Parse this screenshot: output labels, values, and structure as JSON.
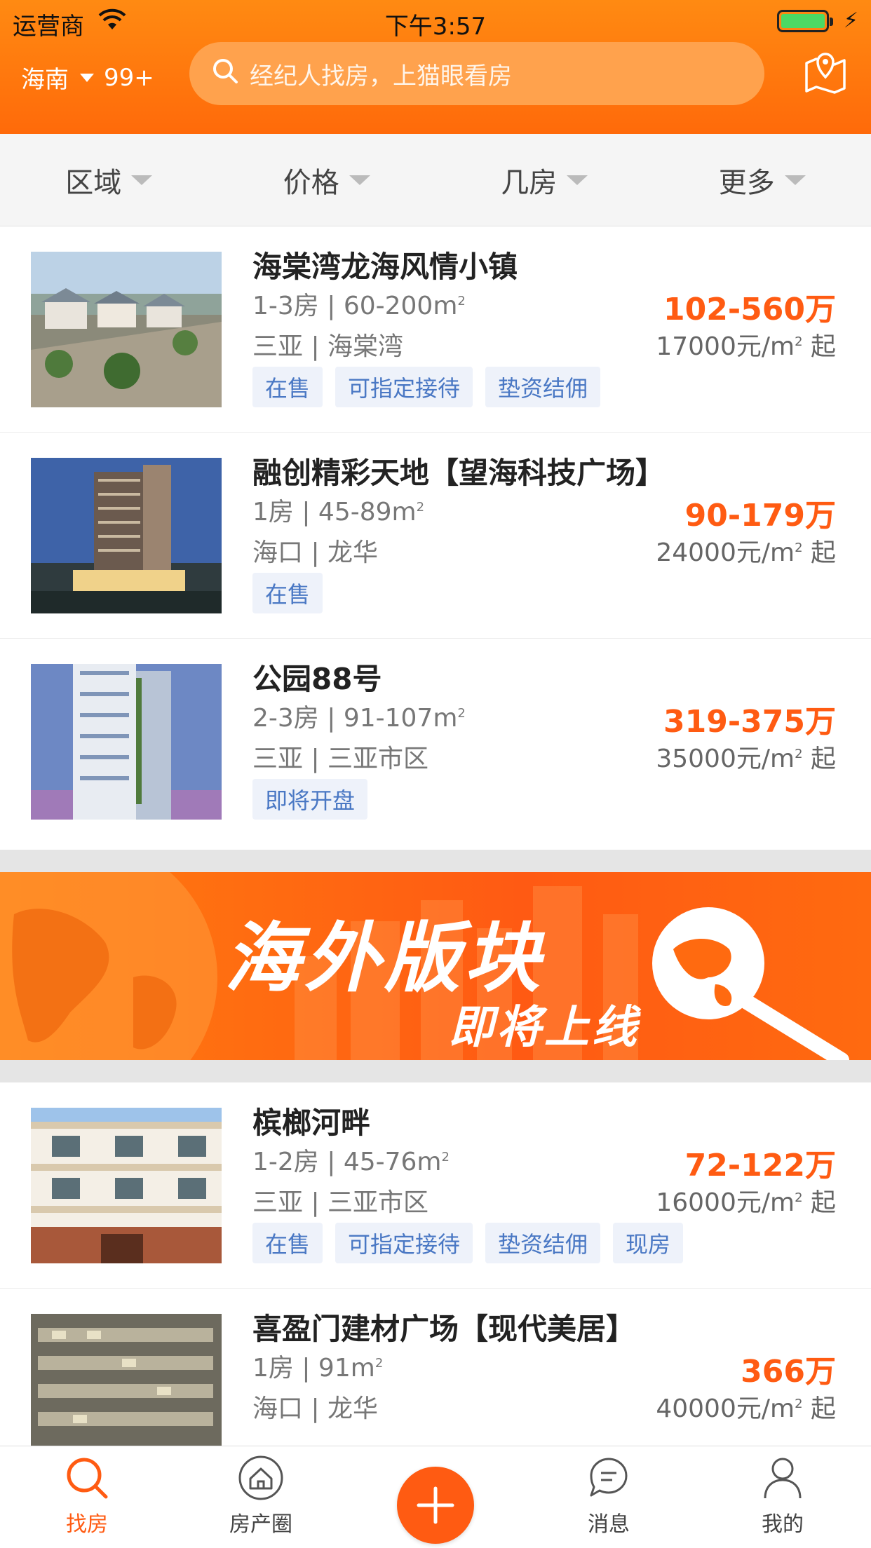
{
  "status": {
    "carrier": "运营商",
    "time": "下午3:57"
  },
  "header": {
    "city": "海南",
    "badge": "99+",
    "search_placeholder": "经纪人找房，上猫眼看房"
  },
  "filters": [
    "区域",
    "价格",
    "几房",
    "更多"
  ],
  "listings": [
    {
      "title": "海棠湾龙海风情小镇",
      "rooms": "1-3房",
      "area": "60-200m",
      "city": "三亚",
      "district": "海棠湾",
      "price": "102-560万",
      "unit_price": "17000元/m",
      "unit_suffix": "起",
      "tags": [
        "在售",
        "可指定接待",
        "垫资结佣"
      ]
    },
    {
      "title": "融创精彩天地【望海科技广场】",
      "rooms": "1房",
      "area": "45-89m",
      "city": "海口",
      "district": "龙华",
      "price": "90-179万",
      "unit_price": "24000元/m",
      "unit_suffix": "起",
      "tags": [
        "在售"
      ]
    },
    {
      "title": "公园88号",
      "rooms": "2-3房",
      "area": "91-107m",
      "city": "三亚",
      "district": "三亚市区",
      "price": "319-375万",
      "unit_price": "35000元/m",
      "unit_suffix": "起",
      "tags": [
        "即将开盘"
      ]
    },
    {
      "title": "槟榔河畔",
      "rooms": "1-2房",
      "area": "45-76m",
      "city": "三亚",
      "district": "三亚市区",
      "price": "72-122万",
      "unit_price": "16000元/m",
      "unit_suffix": "起",
      "tags": [
        "在售",
        "可指定接待",
        "垫资结佣",
        "现房"
      ]
    },
    {
      "title": "喜盈门建材广场【现代美居】",
      "rooms": "1房",
      "area": "91m",
      "city": "海口",
      "district": "龙华",
      "price": "366万",
      "unit_price": "40000元/m",
      "unit_suffix": "起",
      "tags": []
    }
  ],
  "banner": {
    "line1": "海外版块",
    "line2": "即将上线"
  },
  "tabbar": {
    "tab1": "找房",
    "tab2": "房产圈",
    "tab4": "消息",
    "tab5": "我的"
  },
  "colors": {
    "accent": "#ff5b12",
    "header": "#ff7a0e",
    "tag_bg": "#eef2fa",
    "tag_text": "#4a78c4"
  }
}
